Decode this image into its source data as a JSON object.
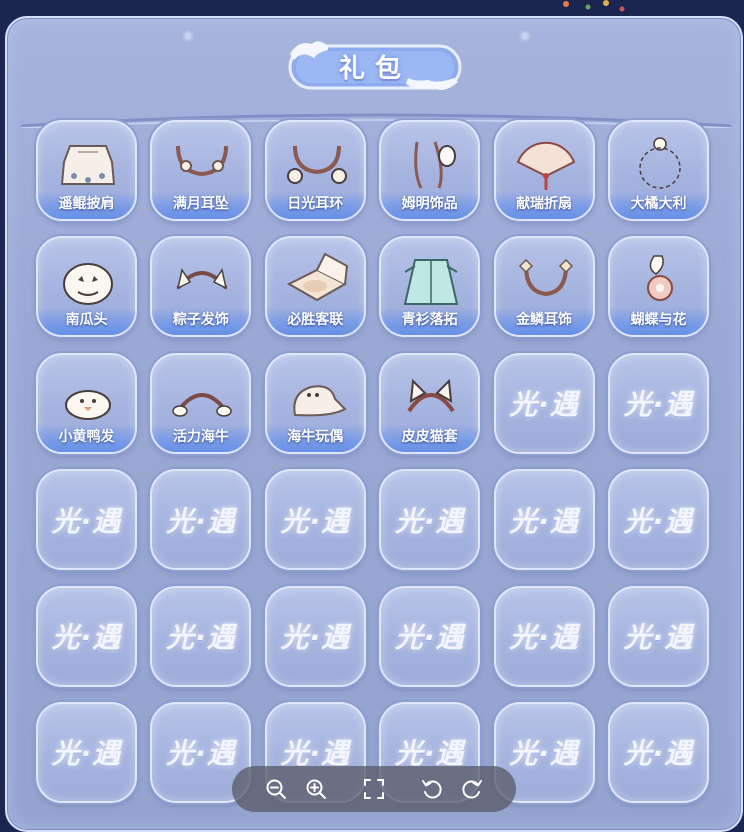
{
  "panel": {
    "title": "礼包"
  },
  "watermark_text": "光·遇",
  "items": [
    {
      "label": "遥鲲披肩",
      "icon": "cape-icon"
    },
    {
      "label": "满月耳坠",
      "icon": "moon-earring-icon"
    },
    {
      "label": "日光耳环",
      "icon": "sun-earring-icon"
    },
    {
      "label": "姆明饰品",
      "icon": "moomin-accessory-icon"
    },
    {
      "label": "献瑞折扇",
      "icon": "folding-fan-icon"
    },
    {
      "label": "大橘大利",
      "icon": "orange-charm-icon"
    },
    {
      "label": "南瓜头",
      "icon": "pumpkin-head-icon"
    },
    {
      "label": "粽子发饰",
      "icon": "zongzi-hairpiece-icon"
    },
    {
      "label": "必胜客联",
      "icon": "pizza-box-icon"
    },
    {
      "label": "青衫落拓",
      "icon": "green-robe-icon"
    },
    {
      "label": "金鳞耳饰",
      "icon": "gold-scale-earring-icon"
    },
    {
      "label": "蝴蝶与花",
      "icon": "butterfly-flower-icon"
    },
    {
      "label": "小黄鸭发",
      "icon": "duck-hair-icon"
    },
    {
      "label": "活力海牛",
      "icon": "manatee-headband-icon"
    },
    {
      "label": "海牛玩偶",
      "icon": "manatee-plush-icon"
    },
    {
      "label": "皮皮猫套",
      "icon": "cat-ears-icon"
    }
  ],
  "empty_slot_count": 20,
  "toolbar": {
    "zoom_out": "zoom-out-icon",
    "zoom_in": "zoom-in-icon",
    "fullscreen": "fullscreen-icon",
    "rotate_left": "rotate-left-icon",
    "rotate_right": "rotate-right-icon"
  },
  "colors": {
    "panel_bg": "#a7b4dc",
    "slot_border": "#dfe7ff",
    "label_band": "#6e96eb",
    "title_plate": "#8fb0f0",
    "toolbar_bg": "#5a5c69"
  }
}
